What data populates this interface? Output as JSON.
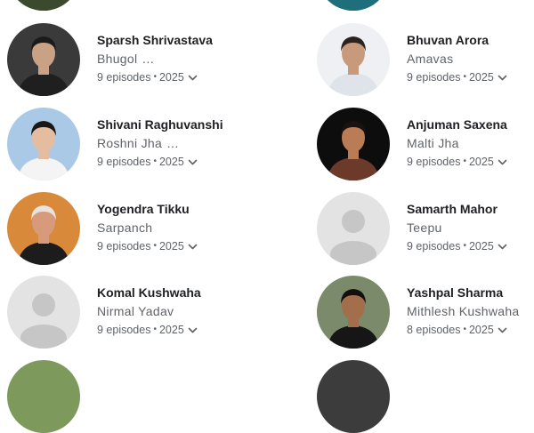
{
  "cast": [
    {
      "name": "Sparsh Shrivastava",
      "role": "Bhugol",
      "ellipsis": "…",
      "episodes": "9 episodes",
      "year": "2025",
      "avatar": "photo",
      "skin": "#c9a184",
      "hair": "#1b1b1b",
      "shirt": "#1f1f1f",
      "bg": "#3a3a3a"
    },
    {
      "name": "Bhuvan Arora",
      "role": "Amavas",
      "ellipsis": "",
      "episodes": "9 episodes",
      "year": "2025",
      "avatar": "photo",
      "skin": "#c89a7c",
      "hair": "#2a2320",
      "shirt": "#dfe3ea",
      "bg": "#eef0f3"
    },
    {
      "name": "Shivani Raghuvanshi",
      "role": "Roshni Jha",
      "ellipsis": "…",
      "episodes": "9 episodes",
      "year": "2025",
      "avatar": "photo",
      "skin": "#e4bda0",
      "hair": "#1c1614",
      "shirt": "#f4f4f4",
      "bg": "#a9c9e6"
    },
    {
      "name": "Anjuman Saxena",
      "role": "Malti Jha",
      "ellipsis": "",
      "episodes": "9 episodes",
      "year": "2025",
      "avatar": "photo",
      "skin": "#b97c55",
      "hair": "#1a1210",
      "shirt": "#6b3a2a",
      "bg": "#0d0d0d"
    },
    {
      "name": "Yogendra Tikku",
      "role": "Sarpanch",
      "ellipsis": "",
      "episodes": "9 episodes",
      "year": "2025",
      "avatar": "photo",
      "skin": "#d79b7c",
      "hair": "#e8e3de",
      "shirt": "#1c1c1c",
      "bg": "#d88a3a"
    },
    {
      "name": "Samarth Mahor",
      "role": "Teepu",
      "ellipsis": "",
      "episodes": "9 episodes",
      "year": "2025",
      "avatar": "placeholder"
    },
    {
      "name": "Komal Kushwaha",
      "role": "Nirmal Yadav",
      "ellipsis": "",
      "episodes": "9 episodes",
      "year": "2025",
      "avatar": "placeholder"
    },
    {
      "name": "Yashpal Sharma",
      "role": "Mithlesh Kushwaha",
      "ellipsis": "",
      "episodes": "8 episodes",
      "year": "2025",
      "avatar": "photo",
      "skin": "#a36e4c",
      "hair": "#141010",
      "shirt": "#161616",
      "bg": "#7a8a6a"
    }
  ],
  "separator": "•",
  "icons": {
    "expand": "chevron-down-icon",
    "placeholder": "person-placeholder-icon"
  },
  "colors": {
    "placeholder_bg": "#e3e3e3",
    "placeholder_fg": "#c6c6c6",
    "secondary_text": "#5f6368"
  }
}
